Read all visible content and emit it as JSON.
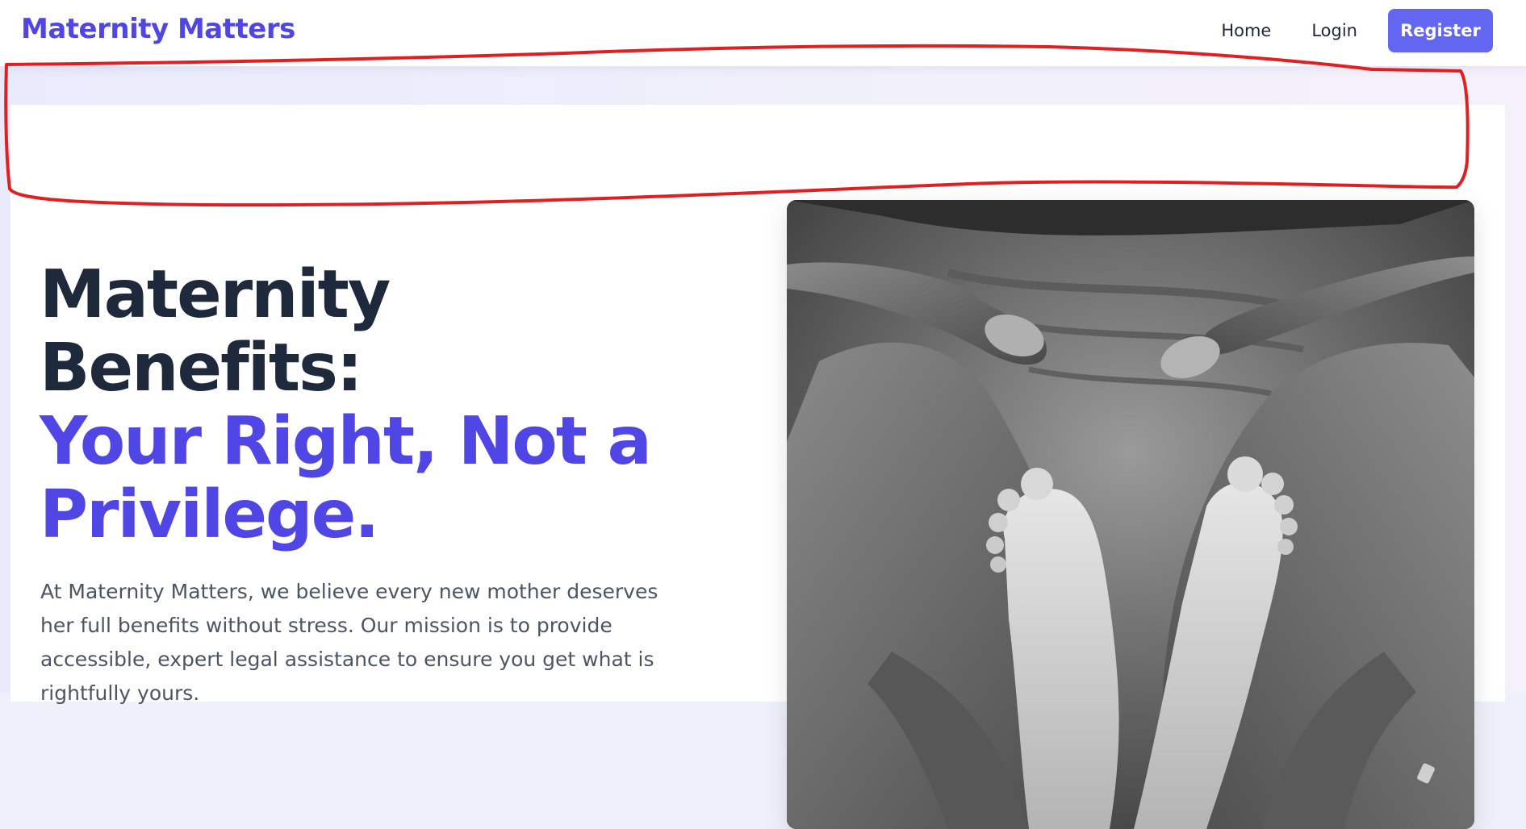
{
  "header": {
    "brand": "Maternity Matters",
    "nav": {
      "home_label": "Home",
      "login_label": "Login",
      "register_label": "Register"
    }
  },
  "hero": {
    "title_line1": "Maternity",
    "title_line2": "Benefits:",
    "title_accent_line1": "Your Right, Not a",
    "title_accent_line2": "Privilege.",
    "description": "At Maternity Matters, we believe every new mother deserves her full benefits without stress. Our mission is to provide accessible, expert legal assistance to ensure you get what is rightfully yours."
  },
  "colors": {
    "brand": "#4f46e5",
    "button": "#6366f1",
    "heading": "#1e293b",
    "body_text": "#4b5563",
    "annotation": "#e02020"
  }
}
